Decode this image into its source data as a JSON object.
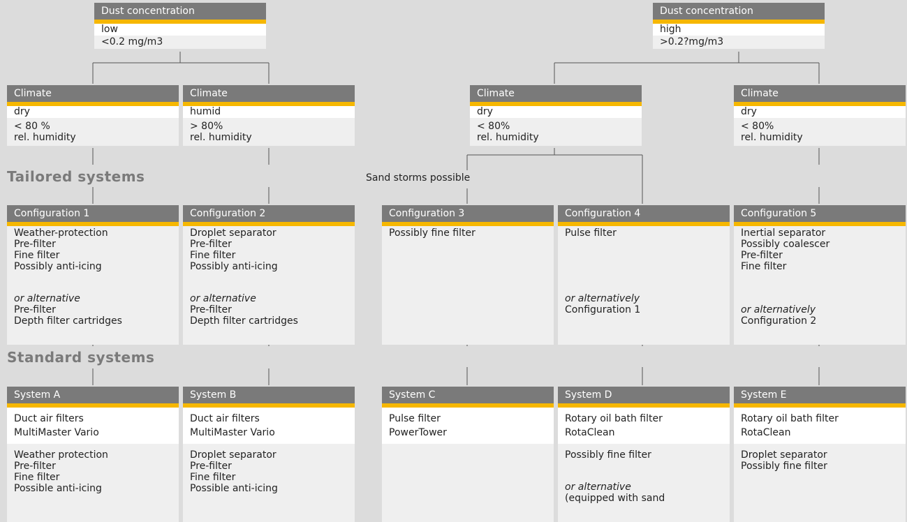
{
  "dust_low": {
    "title": "Dust concentration",
    "level": "low",
    "value": "<0.2 mg/m3"
  },
  "dust_high": {
    "title": "Dust concentration",
    "level": "high",
    "value": ">0.2?mg/m3"
  },
  "climate": [
    {
      "title": "Climate",
      "kind": "dry",
      "line1": "< 80 %",
      "line2": "rel. humidity"
    },
    {
      "title": "Climate",
      "kind": "humid",
      "line1": "> 80%",
      "line2": "rel. humidity"
    },
    {
      "title": "Climate",
      "kind": "dry",
      "line1": "< 80%",
      "line2": "rel. humidity"
    },
    {
      "title": "Climate",
      "kind": "dry",
      "line1": "< 80%",
      "line2": "rel. humidity"
    }
  ],
  "sections": {
    "tailored": "Tailored systems",
    "standard": "Standard systems"
  },
  "note_sand": "Sand storms possible",
  "configs": [
    {
      "title": "Configuration 1",
      "lines": [
        "Weather-protection",
        "Pre-filter",
        "Fine filter",
        "Possibly anti-icing"
      ],
      "alt_label": "or alternative",
      "alt_lines": [
        "Pre-filter",
        "Depth filter cartridges"
      ]
    },
    {
      "title": "Configuration 2",
      "lines": [
        "Droplet separator",
        "Pre-filter",
        "Fine filter",
        "Possibly anti-icing"
      ],
      "alt_label": "or alternative",
      "alt_lines": [
        "Pre-filter",
        "Depth filter cartridges"
      ]
    },
    {
      "title": "Configuration 3",
      "lines": [
        "Possibly fine filter"
      ],
      "alt_label": "",
      "alt_lines": []
    },
    {
      "title": "Configuration 4",
      "lines": [
        "Pulse filter"
      ],
      "alt_label": "or alternatively",
      "alt_lines": [
        "Configuration 1"
      ]
    },
    {
      "title": "Configuration 5",
      "lines": [
        "Inertial separator",
        "Possibly coalescer",
        "Pre-filter",
        "Fine filter"
      ],
      "alt_label": "or alternatively",
      "alt_lines": [
        "Configuration 2"
      ]
    }
  ],
  "systems": [
    {
      "title": "System A",
      "top": [
        "Duct air filters",
        "MultiMaster Vario"
      ],
      "bottom": [
        "Weather protection",
        "Pre-filter",
        "Fine filter",
        "Possible anti-icing"
      ]
    },
    {
      "title": "System B",
      "top": [
        "Duct air filters",
        "MultiMaster Vario"
      ],
      "bottom": [
        "Droplet separator",
        "Pre-filter",
        "Fine filter",
        "Possible anti-icing"
      ]
    },
    {
      "title": "System C",
      "top": [
        "Pulse filter",
        "PowerTower"
      ],
      "bottom": []
    },
    {
      "title": "System D",
      "top": [
        "Rotary oil bath filter",
        "RotaClean"
      ],
      "bottom": [
        "Possibly fine filter"
      ],
      "alt_label": "or alternative",
      "alt_lines": [
        "(equipped with sand"
      ]
    },
    {
      "title": "System E",
      "top": [
        "Rotary oil bath filter",
        "RotaClean"
      ],
      "bottom": [
        "Droplet separator",
        "Possibly fine filter"
      ]
    }
  ]
}
